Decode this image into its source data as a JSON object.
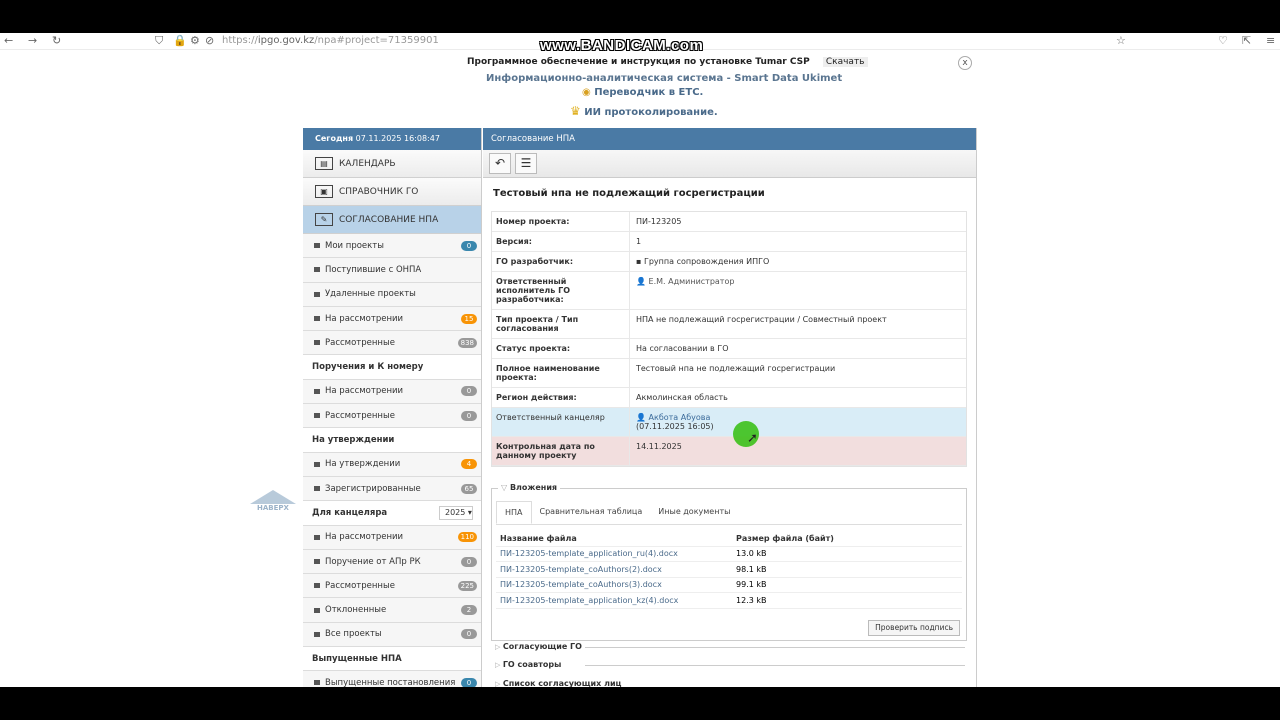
{
  "browser": {
    "url_prefix": "https://",
    "url_host": "ipgo.gov.kz",
    "url_path": "/npa#project=71359901"
  },
  "watermark": "www.BANDICAM.com",
  "top_info": {
    "software_link": "Программное обеспечение и инструкция по установке Tumar CSP",
    "download": "Скачать",
    "system_name": "Информационно-аналитическая система - Smart Data Ukimet",
    "translator": "Переводчик в ЕТС.",
    "protocol": "ИИ протоколирование.",
    "close": "x"
  },
  "sidebar": {
    "today_label": "Сегодня",
    "today_value": "07.11.2025 16:08:47",
    "main_items": [
      {
        "label": "КАЛЕНДАРЬ"
      },
      {
        "label": "СПРАВОЧНИК ГО"
      },
      {
        "label": "СОГЛАСОВАНИЕ НПА"
      }
    ],
    "group1": [
      {
        "label": "Мои проекты",
        "count": "0"
      },
      {
        "label": "Поступившие с ОНПА",
        "count": ""
      },
      {
        "label": "Удаленные проекты",
        "count": ""
      },
      {
        "label": "На рассмотрении",
        "count": "15"
      },
      {
        "label": "Рассмотренные",
        "count": "838"
      }
    ],
    "section_orders": "Поручения и К номеру",
    "group2": [
      {
        "label": "На рассмотрении",
        "count": "0"
      },
      {
        "label": "Рассмотренные",
        "count": "0"
      }
    ],
    "section_approval": "На утверждении",
    "group3": [
      {
        "label": "На утверждении",
        "count": "4"
      },
      {
        "label": "Зарегистрированные",
        "count": "65"
      }
    ],
    "section_chancellery": "Для канцеляра",
    "year": "2025",
    "group4": [
      {
        "label": "На рассмотрении",
        "count": "110"
      },
      {
        "label": "Поручение от АПр РК",
        "count": "0"
      },
      {
        "label": "Рассмотренные",
        "count": "225"
      },
      {
        "label": "Отклоненные",
        "count": "2"
      },
      {
        "label": "Все проекты",
        "count": "0"
      }
    ],
    "section_issued": "Выпущенные НПА",
    "group5": [
      {
        "label": "Выпущенные постановления",
        "count": "0"
      }
    ]
  },
  "naverh": "НАВЕРХ",
  "main": {
    "header": "Согласование НПА",
    "doc_title": "Тестовый нпа не подлежащий госрегистрации",
    "details": [
      {
        "key": "Номер проекта:",
        "value": "ПИ-123205"
      },
      {
        "key": "Версия:",
        "value": "1"
      },
      {
        "key": "ГО разработчик:",
        "value": "Группа сопровождения ИПГО"
      },
      {
        "key": "Ответственный исполнитель ГО разработчика:",
        "value": "Е.М. Администратор"
      },
      {
        "key": "Тип проекта / Тип согласования",
        "value": "НПА не подлежащий госрегистрации / Совместный проект"
      },
      {
        "key": "Статус проекта:",
        "value": "На согласовании в ГО"
      },
      {
        "key": "Полное наименование проекта:",
        "value": "Тестовый нпа не подлежащий госрегистрации"
      },
      {
        "key": "Регион действия:",
        "value": "Акмолинская область"
      },
      {
        "key": "Ответственный канцеляр",
        "value": "Акбота Абуова",
        "value2": "(07.11.2025 16:05)"
      },
      {
        "key": "Контрольная дата по данному проекту",
        "value": "14.11.2025"
      }
    ],
    "attachments": {
      "legend": "Вложения",
      "tabs": [
        "НПА",
        "Сравнительная таблица",
        "Иные документы"
      ],
      "col_name": "Название файла",
      "col_size": "Размер файла (байт)",
      "files": [
        {
          "name": "ПИ-123205-template_application_ru(4).docx",
          "size": "13.0 kB"
        },
        {
          "name": "ПИ-123205-template_coAuthors(2).docx",
          "size": "98.1 kB"
        },
        {
          "name": "ПИ-123205-template_coAuthors(3).docx",
          "size": "99.1 kB"
        },
        {
          "name": "ПИ-123205-template_application_kz(4).docx",
          "size": "12.3 kB"
        }
      ],
      "verify_button": "Проверить подпись"
    },
    "sections": [
      "Согласующие ГО",
      "ГО соавторы",
      "Список согласующих лиц"
    ]
  }
}
